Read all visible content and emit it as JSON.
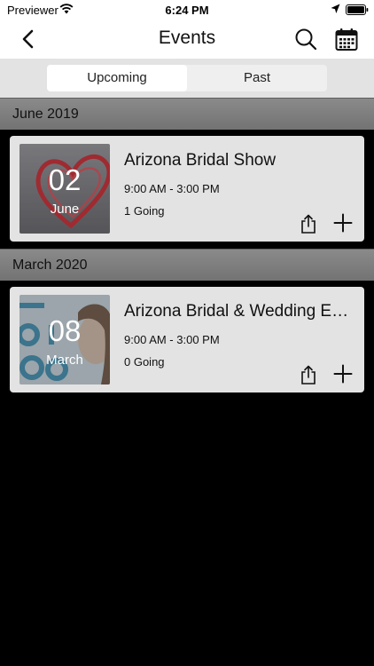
{
  "status_bar": {
    "carrier": "Previewer",
    "time": "6:24 PM"
  },
  "nav": {
    "title": "Events"
  },
  "segments": {
    "upcoming": "Upcoming",
    "past": "Past"
  },
  "sections": [
    {
      "title": "June 2019",
      "events": [
        {
          "day": "02",
          "month": "June",
          "title": "Arizona Bridal Show",
          "time": "9:00 AM - 3:00 PM",
          "going": "1 Going"
        }
      ]
    },
    {
      "title": "March 2020",
      "events": [
        {
          "day": "08",
          "month": "March",
          "title": "Arizona Bridal & Wedding Expo",
          "time": "9:00 AM - 3:00 PM",
          "going": "0 Going"
        }
      ]
    }
  ],
  "colors": {
    "card_background": "#e3e3e3",
    "section_header": "#808080",
    "page_background": "#000000"
  }
}
